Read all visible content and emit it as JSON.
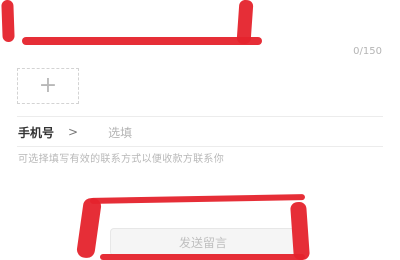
{
  "message": {
    "char_counter": "0/150"
  },
  "upload": {
    "icon": "plus-icon",
    "glyph": "+"
  },
  "phone": {
    "label": "手机号",
    "chevron": ">",
    "placeholder": "选填",
    "hint": "可选择填写有效的联系方式以便收款方联系你"
  },
  "submit": {
    "label": "发送留言"
  },
  "colors": {
    "annotation_red": "#e5232c",
    "disabled_text": "#bfbfbf"
  }
}
